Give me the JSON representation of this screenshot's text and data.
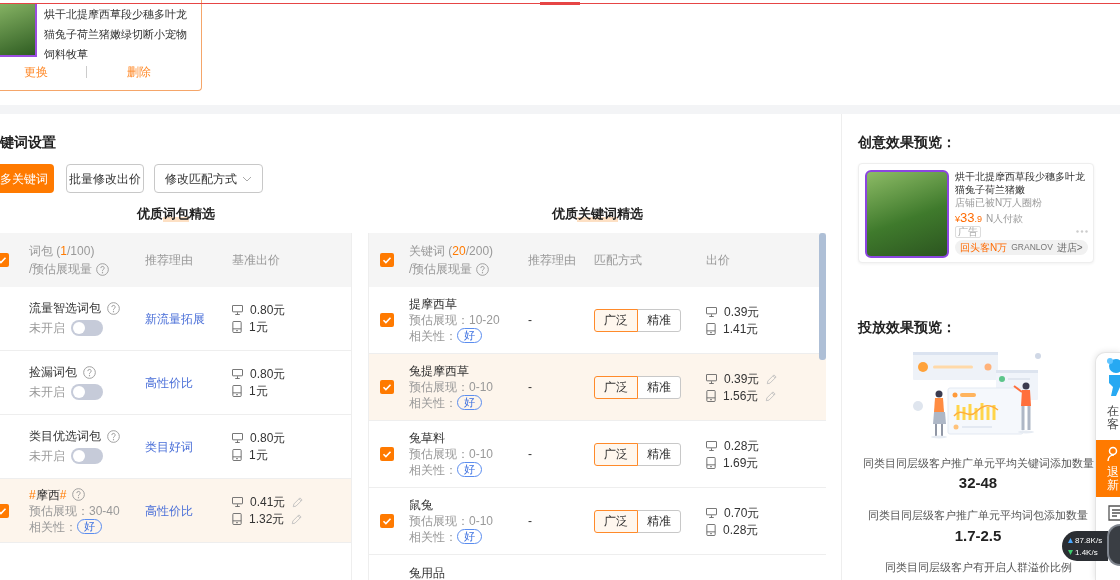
{
  "product_card": {
    "title": "烘干北提摩西草段少穗多叶龙猫兔子荷兰猪嫩绿切断小宠物饲料牧草",
    "actions": [
      "更换",
      "删除"
    ]
  },
  "keyword_settings": {
    "heading": "键词设置",
    "buttons": [
      {
        "label": "多关键词",
        "kind": "primary"
      },
      {
        "label": "批量修改出价",
        "kind": "default"
      }
    ],
    "dropdown": {
      "label": "修改匹配方式"
    },
    "package_table": {
      "title": "优质词包精选",
      "header": {
        "checked": true,
        "title_parts": [
          {
            "text": "词包 (",
            "highlight": false
          },
          {
            "text": "1",
            "highlight": true
          },
          {
            "text": "/100)",
            "highlight": false
          }
        ],
        "subtitle": "/预估展现量",
        "columns": [
          "推荐理由",
          "基准出价"
        ]
      },
      "rows": [
        {
          "kind": "toggle",
          "name_parts": [
            {
              "text": "流量智选词包",
              "highlight": false
            }
          ],
          "status": "未开启",
          "on": false,
          "reason": "新流量拓展",
          "hovered": false,
          "prices": [
            {
              "kind": "pc",
              "value": "0.80元"
            },
            {
              "kind": "mobile",
              "value": "1元"
            }
          ]
        },
        {
          "kind": "toggle",
          "name_parts": [
            {
              "text": "捡漏词包",
              "highlight": false
            }
          ],
          "status": "未开启",
          "on": false,
          "reason": "高性价比",
          "hovered": false,
          "prices": [
            {
              "kind": "pc",
              "value": "0.80元"
            },
            {
              "kind": "mobile",
              "value": "1元"
            }
          ]
        },
        {
          "kind": "toggle",
          "name_parts": [
            {
              "text": "类目优选词包",
              "highlight": false
            }
          ],
          "status": "未开启",
          "on": false,
          "reason": "类目好词",
          "hovered": false,
          "prices": [
            {
              "kind": "pc",
              "value": "0.80元"
            },
            {
              "kind": "mobile",
              "value": "1元"
            }
          ]
        },
        {
          "kind": "checkbox",
          "checked": true,
          "name_parts": [
            {
              "text": "#",
              "highlight": true
            },
            {
              "text": "摩西",
              "highlight": false
            },
            {
              "text": "#",
              "highlight": true
            }
          ],
          "estimate": "预估展现：30-40",
          "relevance_label": "相关性：",
          "relevance": "好",
          "reason": "高性价比",
          "hovered": true,
          "prices": [
            {
              "kind": "pc",
              "value": "0.41元"
            },
            {
              "kind": "mobile",
              "value": "1.32元"
            }
          ]
        }
      ]
    },
    "keyword_table": {
      "title": "优质关键词精选",
      "header": {
        "checked": true,
        "title_parts": [
          {
            "text": "关键词 (",
            "highlight": false
          },
          {
            "text": "20",
            "highlight": true
          },
          {
            "text": "/200)",
            "highlight": false
          }
        ],
        "subtitle": "/预估展现量",
        "columns": [
          "推荐理由",
          "匹配方式",
          "出价"
        ]
      },
      "rows": [
        {
          "checked": true,
          "name": "提摩西草",
          "estimate": "预估展现：10-20",
          "relevance_label": "相关性：",
          "relevance": "好",
          "reason": "-",
          "match": [
            {
              "label": "广泛",
              "selected": true
            },
            {
              "label": "精准",
              "selected": false
            }
          ],
          "hovered": false,
          "prices": [
            {
              "kind": "pc",
              "value": "0.39元"
            },
            {
              "kind": "mobile",
              "value": "1.41元"
            }
          ]
        },
        {
          "checked": true,
          "name": "兔提摩西草",
          "estimate": "预估展现：0-10",
          "relevance_label": "相关性：",
          "relevance": "好",
          "reason": "-",
          "match": [
            {
              "label": "广泛",
              "selected": true
            },
            {
              "label": "精准",
              "selected": false
            }
          ],
          "hovered": true,
          "prices": [
            {
              "kind": "pc",
              "value": "0.39元"
            },
            {
              "kind": "mobile",
              "value": "1.56元"
            }
          ]
        },
        {
          "checked": true,
          "name": "兔草料",
          "estimate": "预估展现：0-10",
          "relevance_label": "相关性：",
          "relevance": "好",
          "reason": "-",
          "match": [
            {
              "label": "广泛",
              "selected": true
            },
            {
              "label": "精准",
              "selected": false
            }
          ],
          "hovered": false,
          "prices": [
            {
              "kind": "pc",
              "value": "0.28元"
            },
            {
              "kind": "mobile",
              "value": "1.69元"
            }
          ]
        },
        {
          "checked": true,
          "name": "鼠兔",
          "estimate": "预估展现：0-10",
          "relevance_label": "相关性：",
          "relevance": "好",
          "reason": "-",
          "match": [
            {
              "label": "广泛",
              "selected": true
            },
            {
              "label": "精准",
              "selected": false
            }
          ],
          "hovered": false,
          "prices": [
            {
              "kind": "pc",
              "value": "0.70元"
            },
            {
              "kind": "mobile",
              "value": "0.28元"
            }
          ]
        },
        {
          "name": "兔用品"
        }
      ]
    }
  },
  "creative_preview": {
    "heading": "创意效果预览：",
    "ad": {
      "title": "烘干北提摩西草段少穗多叶龙猫兔子荷兰猪嫩",
      "shop_note": "店铺已被N万人圈粉",
      "price_parts": [
        {
          "text": "¥",
          "large": false
        },
        {
          "text": "33",
          "large": true
        },
        {
          "text": ".9",
          "large": false
        }
      ],
      "sales": "N人付款",
      "ad_tag": "广告",
      "shop_parts": [
        {
          "text": "回头客N万",
          "kind": "badge"
        },
        {
          "text": "GRANLOV",
          "kind": "brand"
        },
        {
          "text": "进店>",
          "kind": "link"
        }
      ]
    }
  },
  "delivery_preview": {
    "heading": "投放效果预览：",
    "stats": [
      {
        "label": "同类目同层级客户推广单元平均关键词添加数量",
        "value": "32-48"
      },
      {
        "label": "同类目同层级客户推广单元平均词包添加数量",
        "value": "1.7-2.5"
      },
      {
        "label": "同类目同层级客户有开启人群溢价比例"
      }
    ]
  },
  "side_widget": {
    "service_text": [
      "在",
      "客"
    ],
    "promo_text": [
      "退",
      "新"
    ]
  },
  "speed_meter": {
    "upload": "87.8K/s",
    "download": "1.4K/s"
  }
}
